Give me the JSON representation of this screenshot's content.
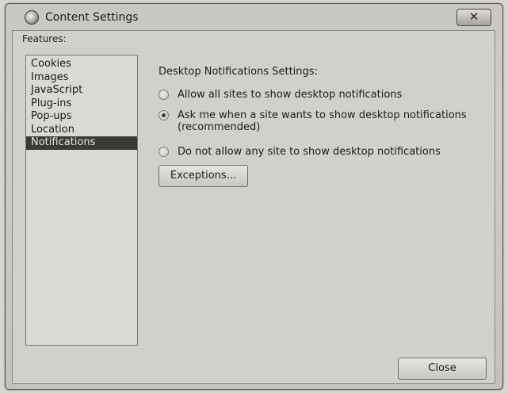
{
  "window": {
    "title": "Content Settings",
    "close_glyph": "✕",
    "icon": "app-icon"
  },
  "features": {
    "label": "Features:",
    "items": [
      {
        "label": "Cookies",
        "selected": false
      },
      {
        "label": "Images",
        "selected": false
      },
      {
        "label": "JavaScript",
        "selected": false
      },
      {
        "label": "Plug-ins",
        "selected": false
      },
      {
        "label": "Pop-ups",
        "selected": false
      },
      {
        "label": "Location",
        "selected": false
      },
      {
        "label": "Notifications",
        "selected": true
      }
    ]
  },
  "settings": {
    "heading": "Desktop Notifications Settings:",
    "options": [
      {
        "label": "Allow all sites to show desktop notifications",
        "checked": false
      },
      {
        "label": "Ask me when a site wants to show desktop notifications",
        "label_line2": "(recommended)",
        "checked": true
      },
      {
        "label": "Do not allow any site to show desktop notifications",
        "checked": false
      }
    ],
    "exceptions_label": "Exceptions..."
  },
  "footer": {
    "close_label": "Close"
  }
}
